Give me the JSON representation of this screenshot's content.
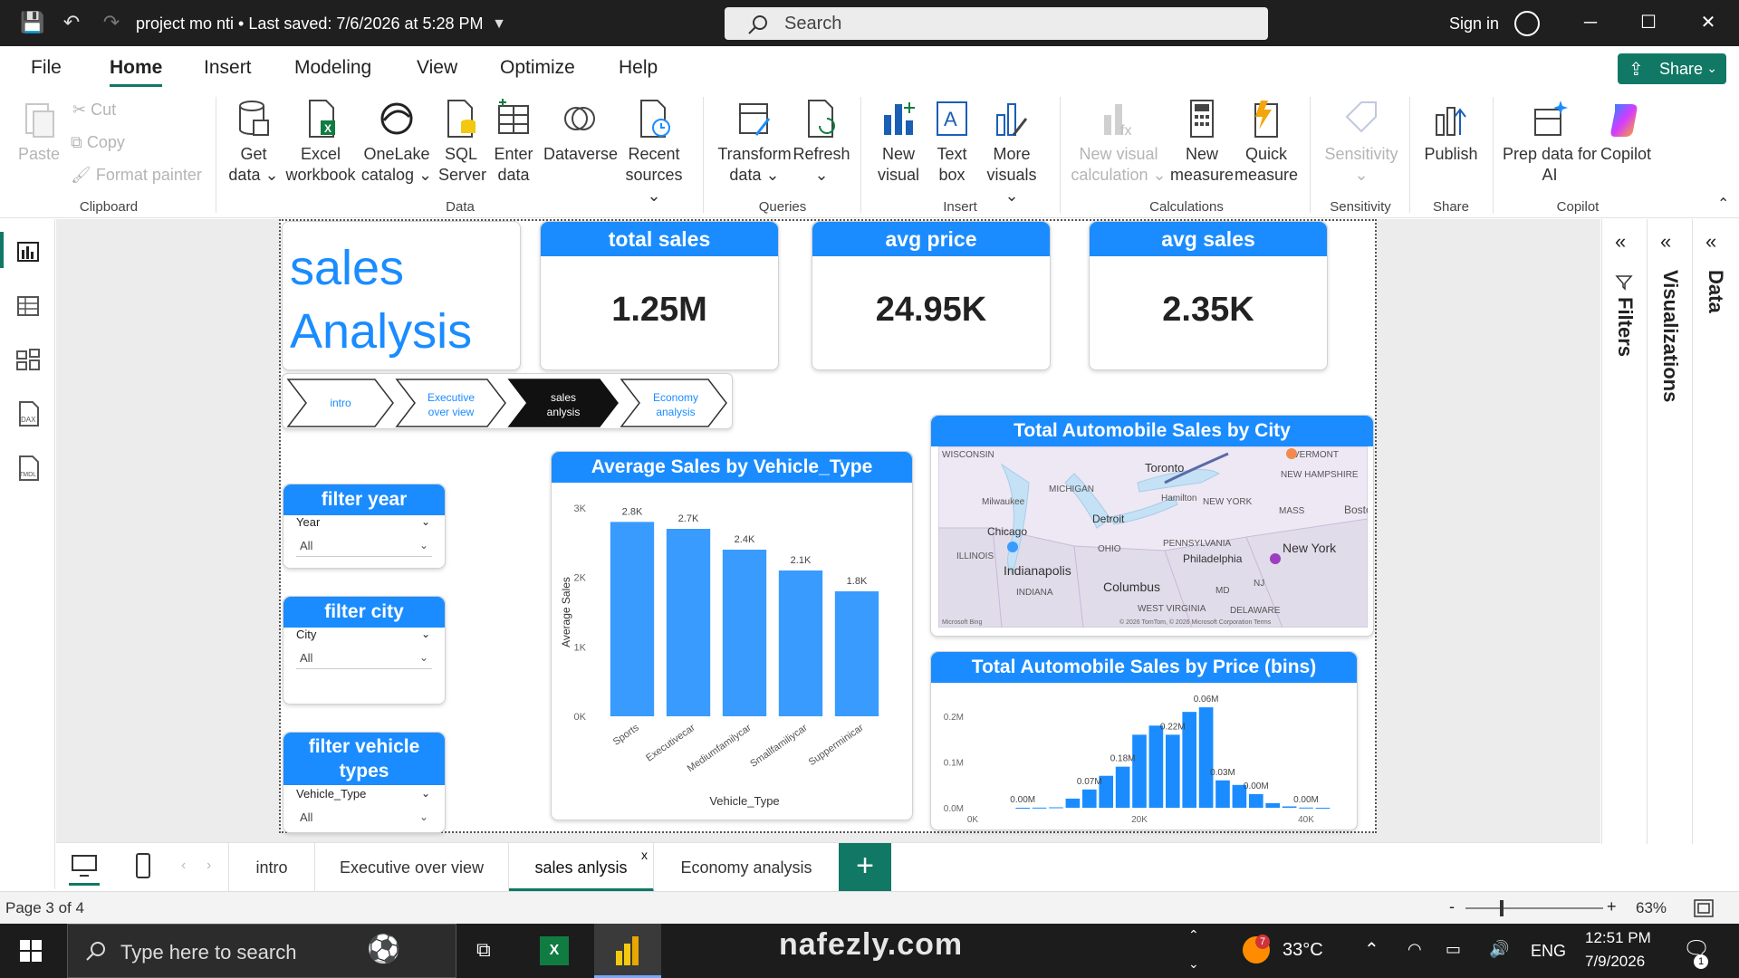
{
  "titlebar": {
    "doc_title": "project mo nti • Last saved: 7/6/2026 at 5:28 PM",
    "search_placeholder": "Search",
    "sign_in": "Sign in"
  },
  "menu": {
    "tabs": [
      "File",
      "Home",
      "Insert",
      "Modeling",
      "View",
      "Optimize",
      "Help"
    ],
    "active": "Home",
    "share": "Share"
  },
  "ribbon": {
    "clipboard": {
      "paste": "Paste",
      "cut": "Cut",
      "copy": "Copy",
      "format_painter": "Format painter",
      "label": "Clipboard"
    },
    "data": {
      "get_data": [
        "Get",
        "data"
      ],
      "excel": [
        "Excel",
        "workbook"
      ],
      "onelake": [
        "OneLake",
        "catalog"
      ],
      "sql": [
        "SQL",
        "Server"
      ],
      "enter": [
        "Enter",
        "data"
      ],
      "dataverse": "Dataverse",
      "recent": [
        "Recent",
        "sources"
      ],
      "label": "Data"
    },
    "queries": {
      "transform": [
        "Transform",
        "data"
      ],
      "refresh": "Refresh",
      "label": "Queries"
    },
    "insert": {
      "new_visual": [
        "New",
        "visual"
      ],
      "text_box": [
        "Text",
        "box"
      ],
      "more_visuals": [
        "More",
        "visuals"
      ],
      "label": "Insert"
    },
    "calculations": {
      "new_visual_calc": [
        "New visual",
        "calculation"
      ],
      "new_measure": [
        "New",
        "measure"
      ],
      "quick_measure": [
        "Quick",
        "measure"
      ],
      "label": "Calculations"
    },
    "sensitivity": {
      "btn": "Sensitivity",
      "label": "Sensitivity"
    },
    "share": {
      "publish": "Publish",
      "label": "Share"
    },
    "copilot": {
      "prep": [
        "Prep data for",
        "AI"
      ],
      "copilot": "Copilot",
      "label": "Copilot"
    }
  },
  "report": {
    "title": [
      "sales",
      "Analysis"
    ],
    "kpis": [
      {
        "title": "total sales",
        "value": "1.25M"
      },
      {
        "title": "avg price",
        "value": "24.95K"
      },
      {
        "title": "avg sales",
        "value": "2.35K"
      }
    ],
    "nav": [
      [
        "intro"
      ],
      [
        "Executive",
        "over view"
      ],
      [
        "sales",
        "anlysis"
      ],
      [
        "Economy",
        "analysis"
      ]
    ],
    "slicers": [
      {
        "title": "filter year",
        "field": "Year",
        "value": "All"
      },
      {
        "title": "filter city",
        "field": "City",
        "value": "All"
      },
      {
        "title": "filter vehicle types",
        "field": "Vehicle_Type",
        "value": "All"
      }
    ],
    "map": {
      "title": "Total Automobile Sales by City",
      "labels": [
        "WISCONSIN",
        "Toronto",
        "VERMONT",
        "NEW HAMPSHIRE",
        "MICHIGAN",
        "Milwaukee",
        "Hamilton",
        "NEW YORK",
        "MASS",
        "Bosto",
        "Detroit",
        "Chicago",
        "OHIO",
        "PENNSYLVANIA",
        "New York",
        "ILLINOIS",
        "Indianapolis",
        "Philadelphia",
        "Columbus",
        "MD",
        "NJ",
        "INDIANA",
        "WEST VIRGINIA",
        "DELAWARE"
      ],
      "attribution": "© 2026 TomTom, © 2026 Microsoft Corporation  Terms",
      "brand": "Microsoft Bing"
    }
  },
  "chart_data": [
    {
      "type": "bar",
      "title": "Average Sales by Vehicle_Type",
      "xlabel": "Vehicle_Type",
      "ylabel": "Average Sales",
      "categories": [
        "Sports",
        "Executivecar",
        "Mediumfamilycar",
        "Smallfamiliycar",
        "Supperminicar"
      ],
      "values": [
        2800,
        2700,
        2400,
        2100,
        1800
      ],
      "data_labels": [
        "2.8K",
        "2.7K",
        "2.4K",
        "2.1K",
        "1.8K"
      ],
      "yticks": [
        "0K",
        "1K",
        "2K",
        "3K"
      ],
      "ylim": [
        0,
        3000
      ],
      "color": "#3a9bff"
    },
    {
      "type": "bar",
      "title": "Total Automobile Sales by Price (bins)",
      "xlabel": "",
      "ylabel": "",
      "x": [
        6000,
        8000,
        10000,
        12000,
        14000,
        16000,
        18000,
        20000,
        22000,
        24000,
        26000,
        28000,
        30000,
        32000,
        34000,
        36000,
        38000,
        40000,
        42000
      ],
      "values": [
        2e-05,
        0.0003,
        0.001,
        0.02,
        0.04,
        0.07,
        0.09,
        0.16,
        0.18,
        0.16,
        0.21,
        0.22,
        0.06,
        0.05,
        0.03,
        0.01,
        0.003,
        0.0004,
        3e-05
      ],
      "data_labels": [
        {
          "x": 6000,
          "text": "0.00M"
        },
        {
          "x": 14000,
          "text": "0.07M"
        },
        {
          "x": 18000,
          "text": "0.18M"
        },
        {
          "x": 24000,
          "text": "0.22M"
        },
        {
          "x": 28000,
          "text": "0.06M"
        },
        {
          "x": 30000,
          "text": "0.03M"
        },
        {
          "x": 34000,
          "text": "0.00M"
        },
        {
          "x": 40000,
          "text": "0.00M"
        }
      ],
      "xticks": [
        "0K",
        "20K",
        "40K"
      ],
      "yticks": [
        "0.0M",
        "0.1M",
        "0.2M"
      ],
      "xlim": [
        0,
        45000
      ],
      "ylim": [
        0,
        0.25
      ],
      "color": "#1a8cff"
    }
  ],
  "pages": {
    "tabs": [
      "intro",
      "Executive over view",
      "sales anlysis",
      "Economy analysis"
    ],
    "active": "sales anlysis",
    "close": "x",
    "add": "+"
  },
  "panes": {
    "filters": "Filters",
    "visualizations": "Visualizations",
    "data": "Data"
  },
  "status": {
    "page": "Page 3 of 4",
    "zoom": "63%"
  },
  "taskbar": {
    "search": "Type here to search",
    "temp": "33°C",
    "lang": "ENG",
    "time": "12:51 PM",
    "date": "7/9/2026",
    "weather_badge": "7",
    "notif": "1",
    "watermark": "nafezly.com"
  }
}
